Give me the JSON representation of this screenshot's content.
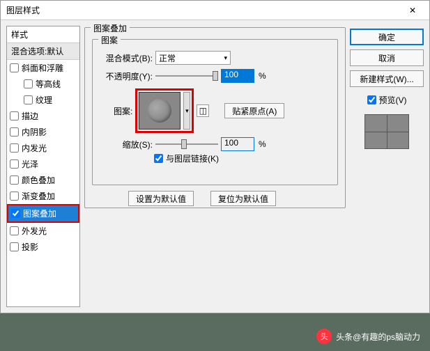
{
  "title": "图层样式",
  "close_glyph": "✕",
  "sidebar": {
    "header": "样式",
    "subheader": "混合选项:默认",
    "items": [
      {
        "label": "斜面和浮雕",
        "checked": false
      },
      {
        "label": "等高线",
        "checked": false,
        "indent": true
      },
      {
        "label": "纹理",
        "checked": false,
        "indent": true
      },
      {
        "label": "描边",
        "checked": false
      },
      {
        "label": "内阴影",
        "checked": false
      },
      {
        "label": "内发光",
        "checked": false
      },
      {
        "label": "光泽",
        "checked": false
      },
      {
        "label": "颜色叠加",
        "checked": false
      },
      {
        "label": "渐变叠加",
        "checked": false
      },
      {
        "label": "图案叠加",
        "checked": true,
        "selected": true
      },
      {
        "label": "外发光",
        "checked": false
      },
      {
        "label": "投影",
        "checked": false
      }
    ]
  },
  "main": {
    "outer_label": "图案叠加",
    "inner_label": "图案",
    "blend_mode_label": "混合模式(B):",
    "blend_mode_value": "正常",
    "opacity_label": "不透明度(Y):",
    "opacity_value": "100",
    "percent": "%",
    "pattern_label": "图案:",
    "snap_origin": "贴紧原点(A)",
    "scale_label": "缩放(S):",
    "scale_value": "100",
    "link_label": "与图层链接(K)",
    "link_checked": true,
    "defaults_btn": "设置为默认值",
    "reset_btn": "复位为默认值",
    "chevron": "▾"
  },
  "right": {
    "ok": "确定",
    "cancel": "取消",
    "new_style": "新建样式(W)...",
    "preview_label": "预览(V)",
    "preview_checked": true
  },
  "watermark": "头条@有趣的ps脑动力",
  "wm_icon": "头"
}
